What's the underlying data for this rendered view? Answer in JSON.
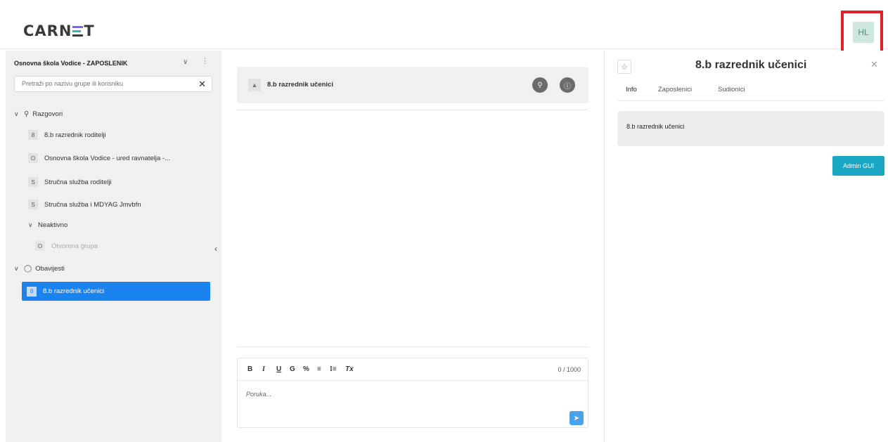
{
  "header": {
    "logo_text_1": "CARN",
    "logo_text_2": "T",
    "avatar_initials": "HL"
  },
  "sidebar": {
    "org_name": "Osnovna škola Vodice - ZAPOSLENIK",
    "search_placeholder": "Pretraži po nazivu grupe ili korisniku",
    "sections": {
      "conversations": "Razgovori",
      "inactive": "Neaktivno",
      "notifications": "Obavijesti"
    },
    "conversations": [
      {
        "letter": "8",
        "label": "8.b razrednik roditelji"
      },
      {
        "letter": "O",
        "label": "Osnovna škola Vodice - ured ravnatelja -..."
      },
      {
        "letter": "S",
        "label": "Stručna služba roditelji"
      },
      {
        "letter": "S",
        "label": "Stručna služba i MDYAG Jmvbfn"
      }
    ],
    "inactive_items": [
      {
        "letter": "O",
        "label": "Otvorena grupa"
      }
    ],
    "notifications_items": [
      {
        "letter": "8",
        "label": "8.b razrednik učenici"
      }
    ]
  },
  "chat": {
    "title": "8.b razrednik učenici",
    "toolbar": {
      "bold": "B",
      "italic": "I",
      "underline": "U",
      "strike": "G",
      "link": "%",
      "bullets": "≡",
      "numbered": "⁝≡",
      "clear": "Tx"
    },
    "counter": "0 / 1000",
    "message_placeholder": "Poruka..."
  },
  "panel": {
    "title": "8.b razrednik učenici",
    "tabs": [
      "Info",
      "Zaposlenici",
      "Sudionici"
    ],
    "info_text": "8.b razrednik učenici",
    "admin_button": "Admin GUI"
  },
  "colors": {
    "accent_blue": "#1a83f0",
    "admin_teal": "#1aa7c4",
    "highlight_red": "#e3202a"
  }
}
